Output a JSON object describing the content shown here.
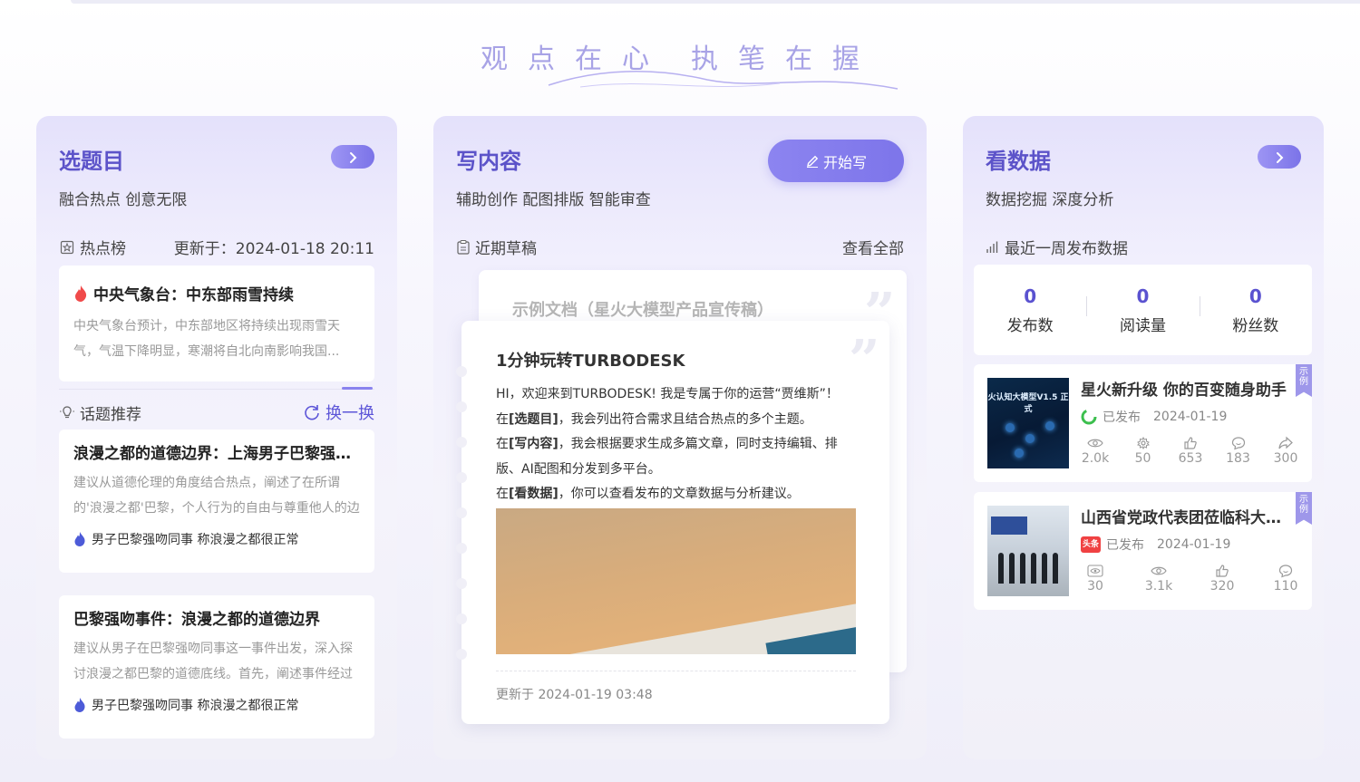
{
  "slogan": {
    "part1": "观点在心",
    "part2": "执笔在握"
  },
  "topics_card": {
    "title": "选题目",
    "subtitle": "融合热点 创意无限",
    "hot_list_label": "热点榜",
    "updated": "更新于：2024-01-18 20:11",
    "hot_item": {
      "title": "中央气象台：中东部雨雪持续",
      "desc": "中央气象台预计，中东部地区将持续出现雨雪天气，气温下降明显，寒潮将自北向南影响我国..."
    },
    "recommend_label": "话题推荐",
    "refresh_label": "换一换",
    "topics": [
      {
        "title": "浪漫之都的道德边界：上海男子巴黎强吻同事",
        "desc": "建议从道德伦理的角度结合热点，阐述了在所谓的'浪漫之都'巴黎，个人行为的自由与尊重他人的边界",
        "tag": "男子巴黎强吻同事 称浪漫之都很正常"
      },
      {
        "title": "巴黎强吻事件：浪漫之都的道德边界",
        "desc": "建议从男子在巴黎强吻同事这一事件出发，深入探讨浪漫之都巴黎的道德底线。首先，阐述事件经过",
        "tag": "男子巴黎强吻同事 称浪漫之都很正常"
      }
    ]
  },
  "write_card": {
    "title": "写内容",
    "subtitle": "辅助创作 配图排版 智能审查",
    "start_button": "开始写",
    "drafts_label": "近期草稿",
    "view_all": "查看全部",
    "back_doc_title": "示例文档（星火大模型产品宣传稿）",
    "doc": {
      "title": "1分钟玩转TURBODESK",
      "line1": "HI，欢迎来到TURBODESK! 我是专属于你的运营“贾维斯”！",
      "line2_tag": "[选题目]",
      "line2_pre": "在",
      "line2": "，我会列出符合需求且结合热点的多个主题。",
      "line3_tag": "[写内容]",
      "line3_pre": "在",
      "line3": "，我会根据要求生成多篇文章，同时支持编辑、排版、AI配图和分发到多平台。",
      "line4_tag": "[看数据]",
      "line4_pre": "在",
      "line4": "，你可以查看发布的文章数据与分析建议。",
      "updated": "更新于 2024-01-19 03:48"
    }
  },
  "data_card": {
    "title": "看数据",
    "subtitle": "数据挖掘 深度分析",
    "weekly_label": "最近一周发布数据",
    "stats": [
      {
        "value": "0",
        "label": "发布数"
      },
      {
        "value": "0",
        "label": "阅读量"
      },
      {
        "value": "0",
        "label": "粉丝数"
      }
    ],
    "ribbon": "示例",
    "posts": [
      {
        "title": "星火新升级 你的百变随身助手",
        "thumb_text": "火认知大模型V1.5 正式",
        "status": "已发布",
        "date": "2024-01-19",
        "platform_icon": "wechat-icon",
        "metrics": [
          {
            "icon": "eye-icon",
            "value": "2.0k"
          },
          {
            "icon": "gear-icon",
            "value": "50"
          },
          {
            "icon": "thumbs-up-icon",
            "value": "653"
          },
          {
            "icon": "comment-icon",
            "value": "183"
          },
          {
            "icon": "share-icon",
            "value": "300"
          }
        ]
      },
      {
        "title": "山西省党政代表团莅临科大讯飞",
        "platform_label": "头条",
        "status": "已发布",
        "date": "2024-01-19",
        "platform_icon": "toutiao-icon",
        "metrics": [
          {
            "icon": "eye-box-icon",
            "value": "30"
          },
          {
            "icon": "eye-icon",
            "value": "3.1k"
          },
          {
            "icon": "thumbs-up-icon",
            "value": "320"
          },
          {
            "icon": "comment-icon",
            "value": "110"
          }
        ]
      }
    ]
  },
  "colors": {
    "accent": "#5c53c9",
    "button_gradient_start": "#8c84f0",
    "button_gradient_end": "#7d75ea"
  }
}
